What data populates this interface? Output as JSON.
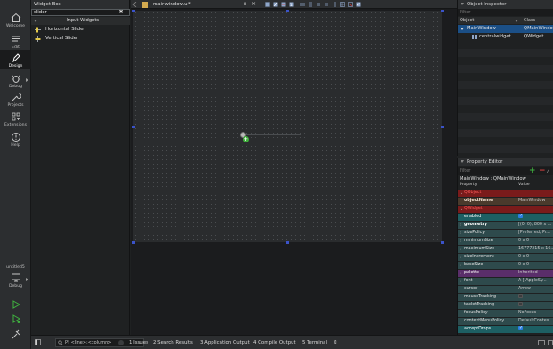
{
  "modebar": {
    "welcome": "Welcome",
    "edit": "Edit",
    "design": "Design",
    "debug": "Debug",
    "projects": "Projects",
    "extensions": "Extensions",
    "help": "Help",
    "target_project": "untitled5",
    "target_mode": "Debug"
  },
  "widgetbox": {
    "title": "Widget Box",
    "filter_value": "slider",
    "clear_glyph": "✖",
    "category": "Input Widgets",
    "items": [
      {
        "label": "Horizontal Slider",
        "icon": "horizontal-slider-icon"
      },
      {
        "label": "Vertical Slider",
        "icon": "vertical-slider-icon"
      }
    ]
  },
  "editor": {
    "doc_tab": "mainwindow.ui*",
    "nav_arrows": "⇕",
    "close_glyph": "×"
  },
  "object_inspector": {
    "title": "Object Inspector",
    "filter_placeholder": "Filter",
    "col_object": "Object",
    "col_class": "Class",
    "rows": [
      {
        "object": "MainWindow",
        "class": "QMainWindow",
        "selected": true
      },
      {
        "object": "centralwidget",
        "class": "QWidget",
        "selected": false
      }
    ]
  },
  "property_editor": {
    "title": "Property Editor",
    "filter_placeholder": "Filter",
    "object_label": "MainWindow : QMainWindow",
    "col_property": "Property",
    "col_value": "Value",
    "rows": [
      {
        "name": "QObject",
        "value": "",
        "kind": "header-red"
      },
      {
        "name": "objectName",
        "value": "MainWindow",
        "kind": "brown-bold"
      },
      {
        "name": "QWidget",
        "value": "",
        "kind": "header-red"
      },
      {
        "name": "enabled",
        "value": "",
        "kind": "teal-check"
      },
      {
        "name": "geometry",
        "value": "[(0, 0), 800 x ...",
        "kind": "teal-bold"
      },
      {
        "name": "sizePolicy",
        "value": "[Preferred, Pr...",
        "kind": "teal"
      },
      {
        "name": "minimumSize",
        "value": "0 x 0",
        "kind": "teal"
      },
      {
        "name": "maximumSize",
        "value": "16777215 x 16...",
        "kind": "teal"
      },
      {
        "name": "sizeIncrement",
        "value": "0 x 0",
        "kind": "teal"
      },
      {
        "name": "baseSize",
        "value": "0 x 0",
        "kind": "teal"
      },
      {
        "name": "palette",
        "value": "Inherited",
        "kind": "purple"
      },
      {
        "name": "font",
        "value": "A  [.AppleSy...",
        "kind": "teal"
      },
      {
        "name": "cursor",
        "value": "Arrow",
        "kind": "teal"
      },
      {
        "name": "mouseTracking",
        "value": "",
        "kind": "teal-uncheck"
      },
      {
        "name": "tabletTracking",
        "value": "",
        "kind": "teal-uncheck"
      },
      {
        "name": "focusPolicy",
        "value": "NoFocus",
        "kind": "teal"
      },
      {
        "name": "contextMenuPolicy",
        "value": "DefaultContex...",
        "kind": "teal"
      },
      {
        "name": "acceptDrops",
        "value": "",
        "kind": "teal-check"
      }
    ]
  },
  "statusbar": {
    "locator_placeholder": "P! <line>:<column>",
    "tabs": [
      {
        "num": "1",
        "label": "Issues"
      },
      {
        "num": "2",
        "label": "Search Results"
      },
      {
        "num": "3",
        "label": "Application Output"
      },
      {
        "num": "4",
        "label": "Compile Output"
      },
      {
        "num": "5",
        "label": "Terminal"
      }
    ],
    "more_glyph": "⇕"
  },
  "colors": {
    "accent": "#2a7de1",
    "selection": "#1b4f86",
    "handle": "#3b53c9",
    "add_green": "#3fae3b"
  }
}
